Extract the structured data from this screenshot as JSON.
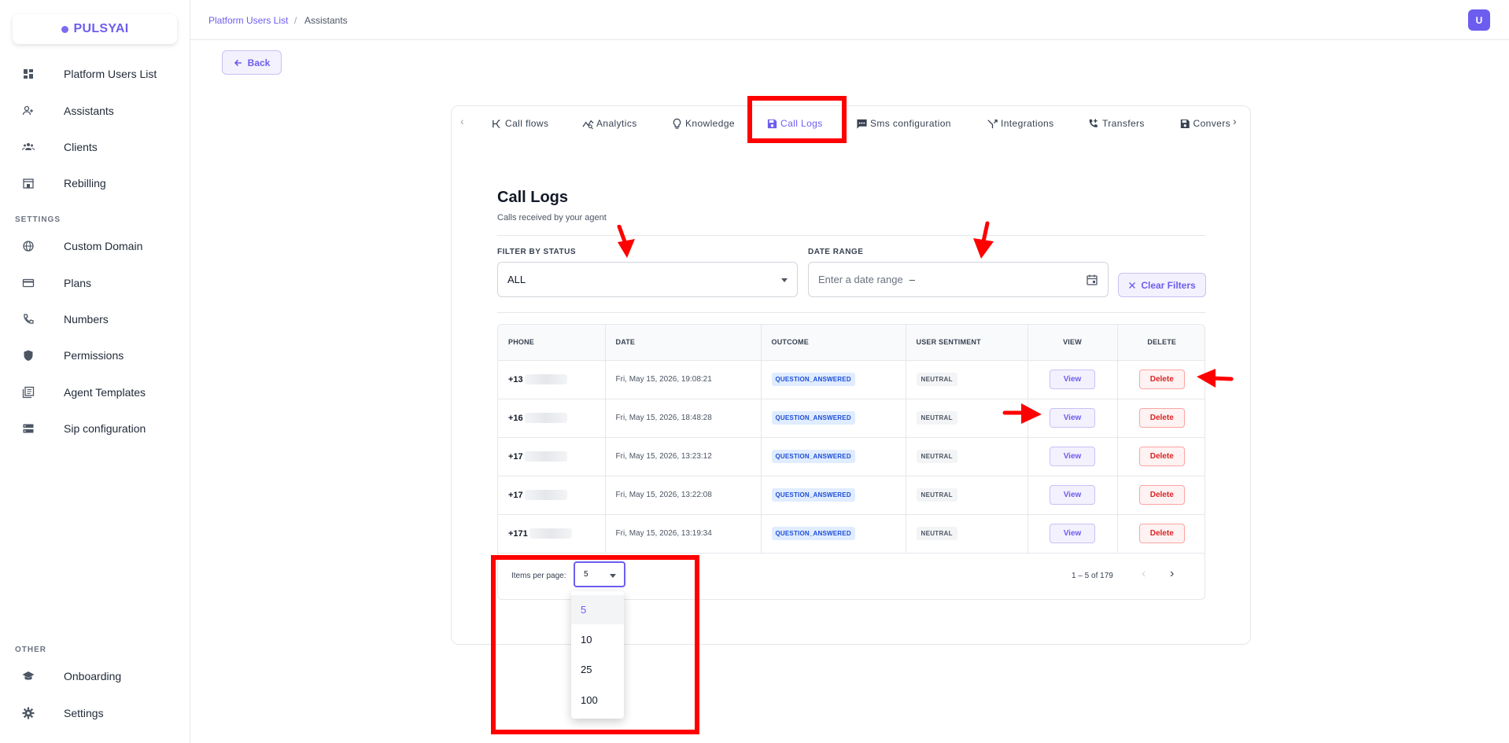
{
  "app": {
    "logo": "PULSYAI",
    "user_initial": "U"
  },
  "sidebar": {
    "items": [
      {
        "label": "Platform Users List",
        "icon": "dashboard-icon"
      },
      {
        "label": "Assistants",
        "icon": "person-add-icon"
      },
      {
        "label": "Clients",
        "icon": "groups-icon"
      },
      {
        "label": "Rebilling",
        "icon": "storefront-icon"
      }
    ],
    "settings_label": "SETTINGS",
    "settings_items": [
      {
        "label": "Custom Domain",
        "icon": "globe-icon"
      },
      {
        "label": "Plans",
        "icon": "credit-card-icon"
      },
      {
        "label": "Numbers",
        "icon": "phone-icon"
      },
      {
        "label": "Permissions",
        "icon": "shield-icon"
      },
      {
        "label": "Agent Templates",
        "icon": "library-books-icon"
      },
      {
        "label": "Sip configuration",
        "icon": "storage-icon"
      }
    ],
    "other_label": "OTHER",
    "other_items": [
      {
        "label": "Onboarding",
        "icon": "school-icon"
      },
      {
        "label": "Settings",
        "icon": "gear-icon"
      }
    ]
  },
  "breadcrumb": {
    "link": "Platform Users List",
    "separator": "/",
    "current": "Assistants"
  },
  "back_label": "Back",
  "tabs": [
    {
      "label": "Call flows",
      "icon": "call-flows-icon"
    },
    {
      "label": "Analytics",
      "icon": "analytics-icon"
    },
    {
      "label": "Knowledge",
      "icon": "lightbulb-icon"
    },
    {
      "label": "Call Logs",
      "icon": "save-icon",
      "active": true
    },
    {
      "label": "Sms configuration",
      "icon": "sms-icon"
    },
    {
      "label": "Integrations",
      "icon": "merge-icon"
    },
    {
      "label": "Transfers",
      "icon": "phone-forward-icon"
    },
    {
      "label": "Convers",
      "icon": "save-icon"
    }
  ],
  "call_logs": {
    "title": "Call Logs",
    "subtitle": "Calls received by your agent",
    "filter_status_label": "FILTER BY STATUS",
    "filter_status_value": "ALL",
    "date_range_label": "DATE RANGE",
    "date_range_placeholder": "Enter a date range",
    "date_range_separator": "–",
    "clear_filters_label": "Clear Filters"
  },
  "table": {
    "columns": [
      "PHONE",
      "DATE",
      "OUTCOME",
      "USER SENTIMENT",
      "VIEW",
      "DELETE"
    ],
    "rows": [
      {
        "phone": "+13",
        "date": "Fri, May 15, 2026, 19:08:21",
        "outcome": "QUESTION_ANSWERED",
        "sentiment": "NEUTRAL",
        "view": "View",
        "delete": "Delete"
      },
      {
        "phone": "+16",
        "date": "Fri, May 15, 2026, 18:48:28",
        "outcome": "QUESTION_ANSWERED",
        "sentiment": "NEUTRAL",
        "view": "View",
        "delete": "Delete"
      },
      {
        "phone": "+17",
        "date": "Fri, May 15, 2026, 13:23:12",
        "outcome": "QUESTION_ANSWERED",
        "sentiment": "NEUTRAL",
        "view": "View",
        "delete": "Delete"
      },
      {
        "phone": "+17",
        "date": "Fri, May 15, 2026, 13:22:08",
        "outcome": "QUESTION_ANSWERED",
        "sentiment": "NEUTRAL",
        "view": "View",
        "delete": "Delete"
      },
      {
        "phone": "+171",
        "date": "Fri, May 15, 2026, 13:19:34",
        "outcome": "QUESTION_ANSWERED",
        "sentiment": "NEUTRAL",
        "view": "View",
        "delete": "Delete"
      }
    ]
  },
  "paginator": {
    "items_per_page_label": "Items per page:",
    "items_per_page_value": "5",
    "range_label": "1 – 5 of 179",
    "options": [
      "5",
      "10",
      "25",
      "100"
    ]
  },
  "colors": {
    "accent": "#6d5dee",
    "annotation_red": "#ff0000",
    "delete_red": "#dc2626"
  }
}
